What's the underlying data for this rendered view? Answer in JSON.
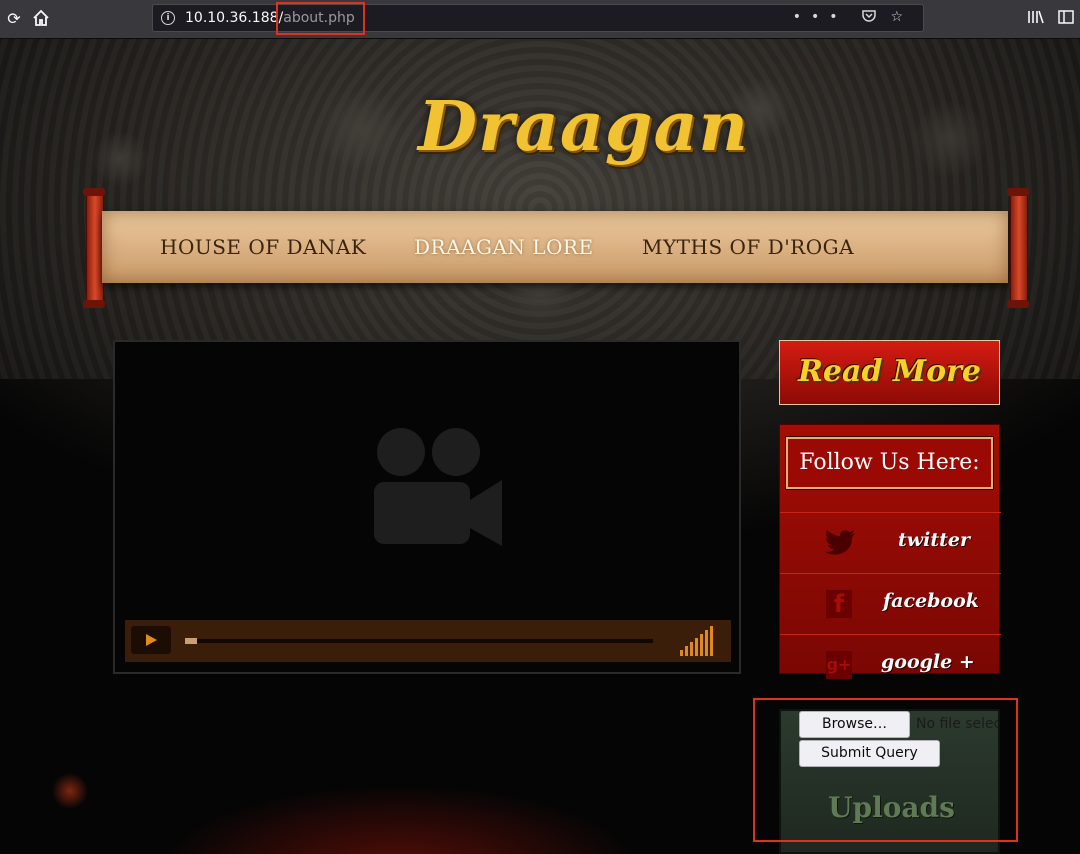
{
  "browser": {
    "url_host": "10.10.36.188/",
    "url_path": "about.php",
    "menu_glyph": "•••"
  },
  "site": {
    "logo_text": "Draagan",
    "nav": [
      {
        "label": "HOUSE OF DANAK",
        "active": false
      },
      {
        "label": "DRAAGAN LORE",
        "active": true
      },
      {
        "label": "MYTHS OF D'ROGA",
        "active": false
      }
    ]
  },
  "sidebar": {
    "read_more_label": "Read More",
    "follow_title": "Follow Us Here:",
    "social": [
      {
        "label": "twitter",
        "icon": "twitter-icon"
      },
      {
        "label": "facebook",
        "icon": "facebook-icon"
      },
      {
        "label": "google +",
        "icon": "google-plus-icon"
      }
    ]
  },
  "upload": {
    "browse_label": "Browse…",
    "no_file_text": "No file selected.",
    "submit_label": "Submit Query",
    "title": "Uploads"
  },
  "video": {
    "progress": 0.02
  },
  "colors": {
    "highlight_box": "#e0301e",
    "accent_red": "#a50d06",
    "player_orange": "#e08a1e"
  }
}
